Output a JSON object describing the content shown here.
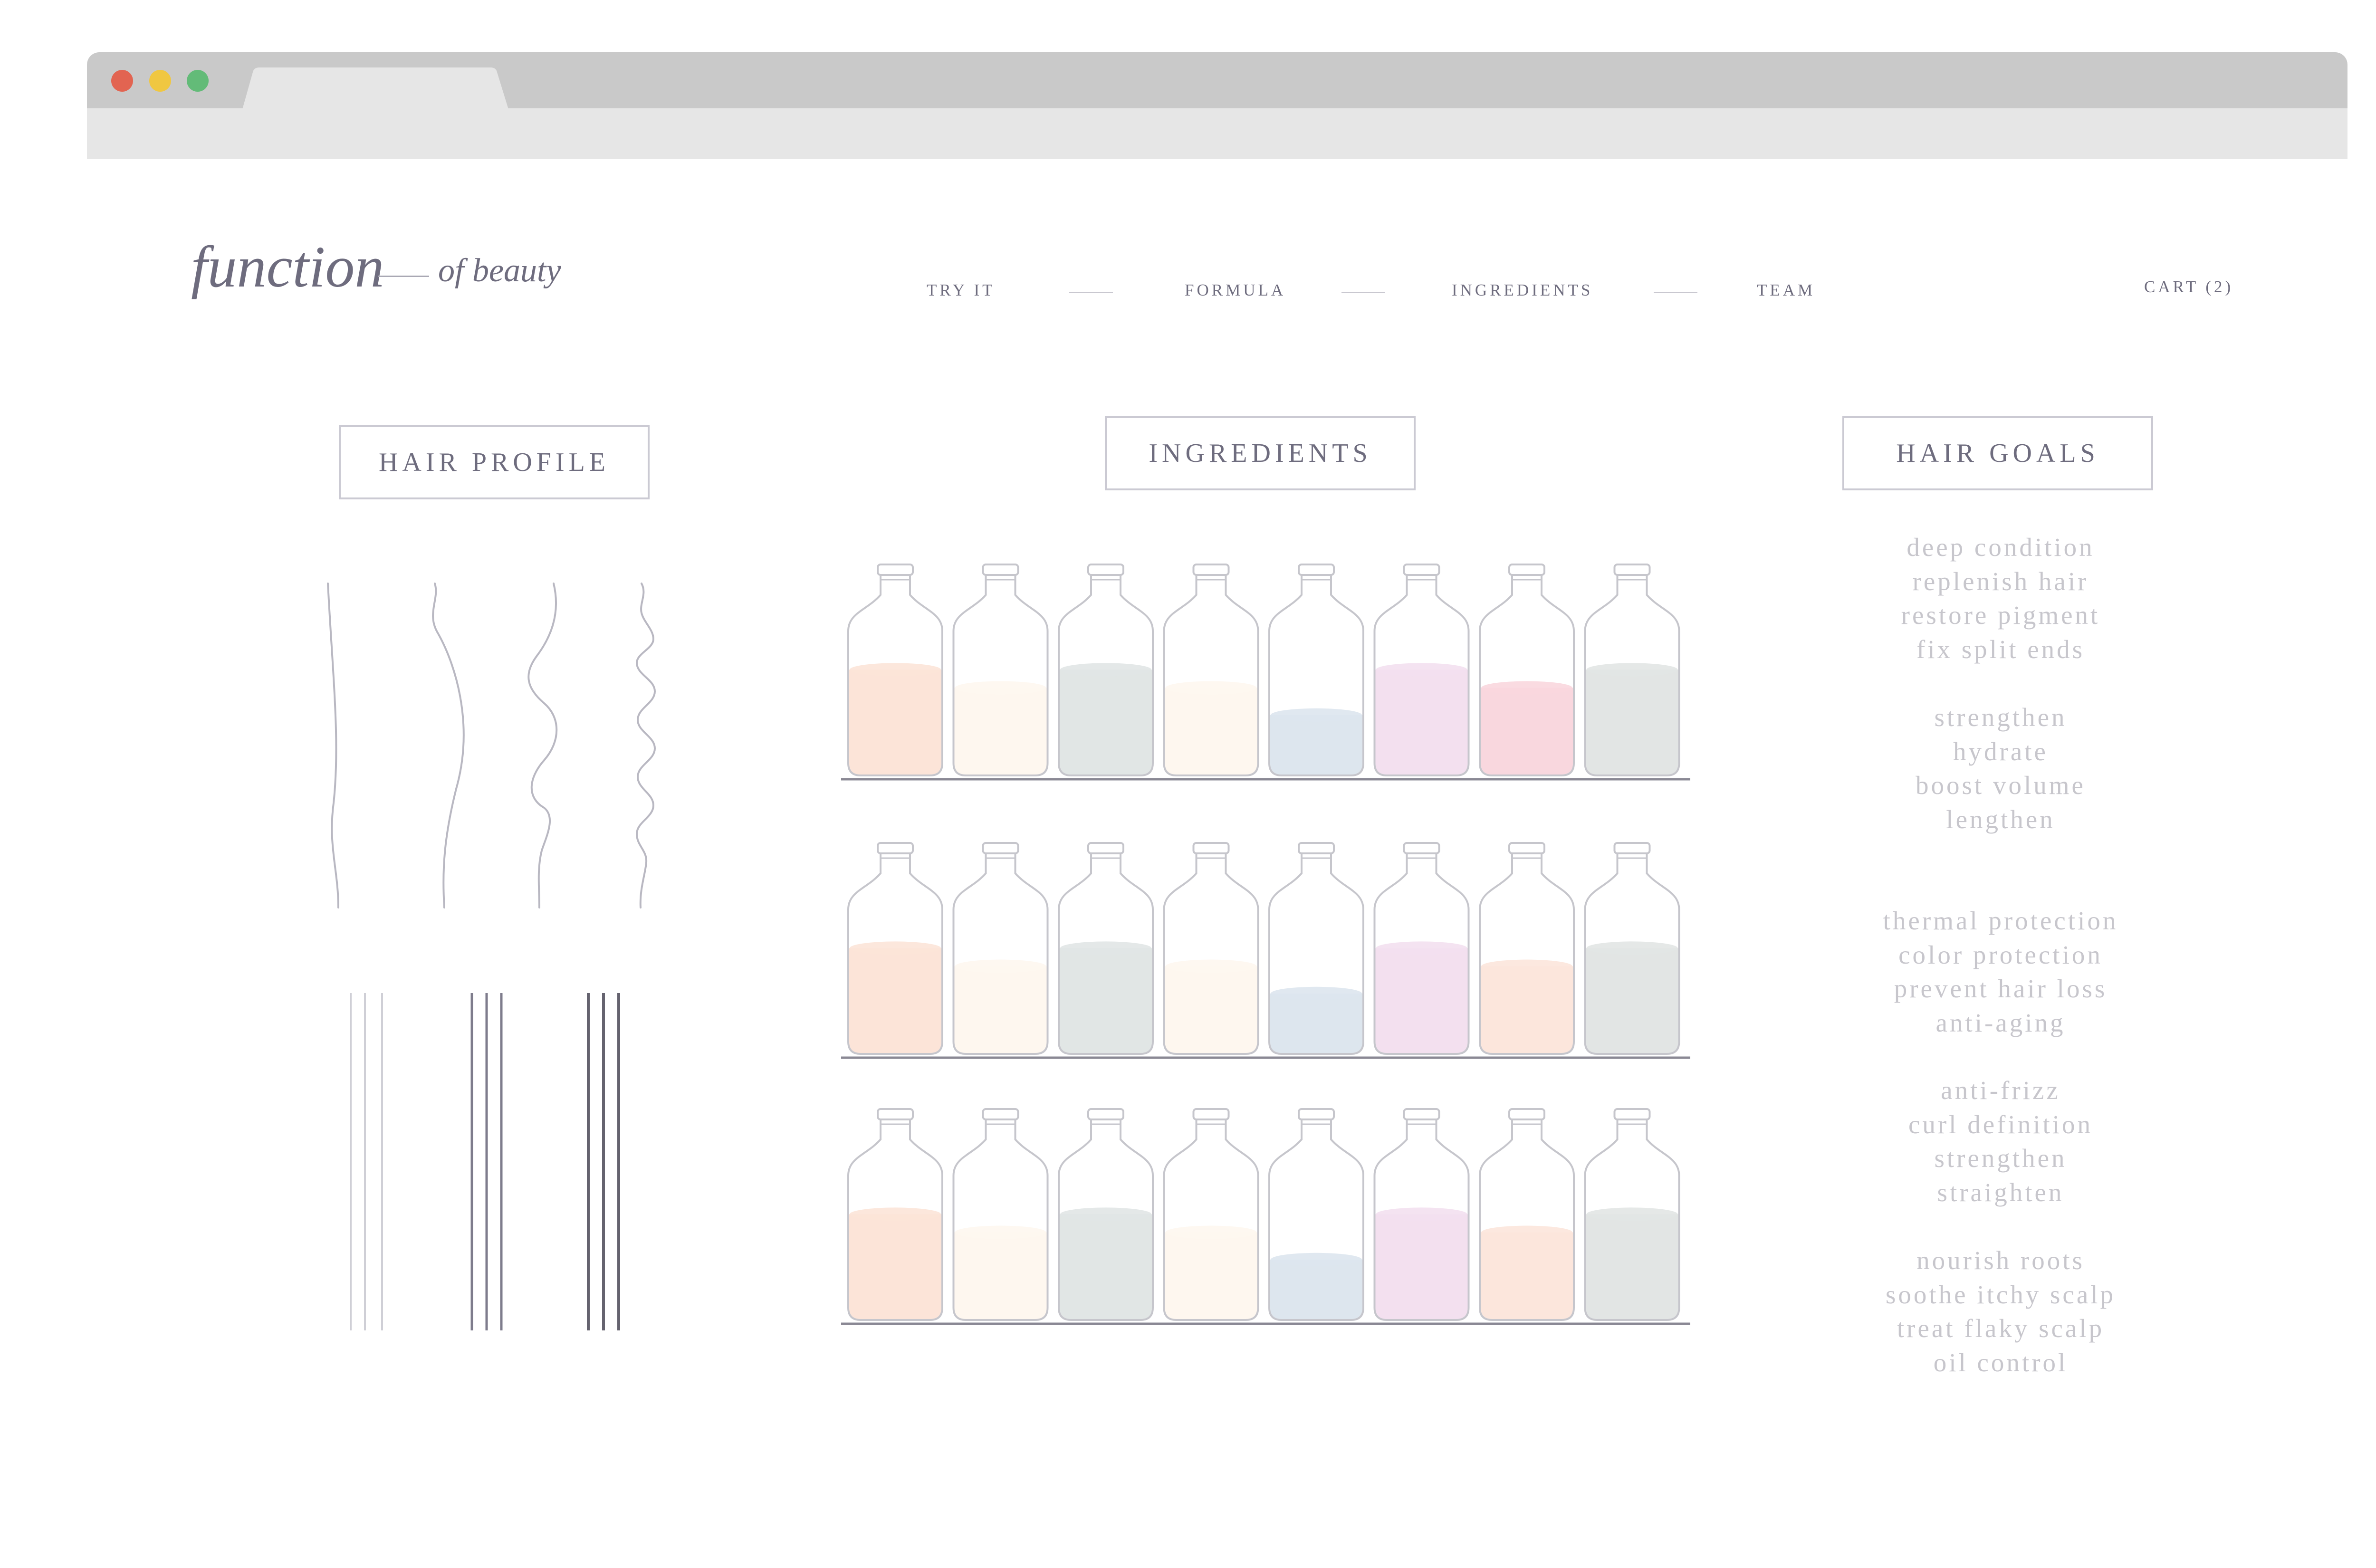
{
  "browser": {
    "window_controls": [
      "close-dot",
      "minimize-dot",
      "maximize-dot"
    ]
  },
  "brand": {
    "logo_main": "function",
    "logo_sub": "of beauty"
  },
  "nav": {
    "items": [
      "TRY IT",
      "FORMULA",
      "INGREDIENTS",
      "TEAM"
    ],
    "cart": "CART (2)"
  },
  "sections": {
    "hair_profile": "HAIR PROFILE",
    "ingredients": "INGREDIENTS",
    "hair_goals": "HAIR GOALS"
  },
  "hair_profile": {
    "hair_types": [
      "straight",
      "wavy",
      "curly",
      "coily"
    ],
    "strand_groups": [
      "thin",
      "medium",
      "thick"
    ]
  },
  "ingredients": {
    "shelves": [
      {
        "fills": [
          0.7,
          0.58,
          0.7,
          0.58,
          0.4,
          0.7,
          0.58,
          0.7
        ],
        "colors": [
          "#fce4d8",
          "#fef7ef",
          "#e1e6e5",
          "#fef7ef",
          "#dde6ee",
          "#f3e0ef",
          "#f9d7de",
          "#e2e5e4"
        ]
      },
      {
        "fills": [
          0.7,
          0.58,
          0.7,
          0.58,
          0.4,
          0.7,
          0.58,
          0.7
        ],
        "colors": [
          "#fce4d8",
          "#fef7ef",
          "#e1e6e5",
          "#fef7ef",
          "#dde6ee",
          "#f3e0ef",
          "#fce6dc",
          "#e2e5e4"
        ]
      },
      {
        "fills": [
          0.7,
          0.58,
          0.7,
          0.58,
          0.4,
          0.7,
          0.58,
          0.7
        ],
        "colors": [
          "#fce4d8",
          "#fef7ef",
          "#e1e6e5",
          "#fef7ef",
          "#dde6ee",
          "#f3e0ef",
          "#fce6dc",
          "#e2e5e4"
        ]
      }
    ]
  },
  "hair_goals": [
    [
      "deep condition",
      "replenish hair",
      "restore pigment",
      "fix split ends"
    ],
    [
      "strengthen",
      "hydrate",
      "boost volume",
      "lengthen"
    ],
    [
      "thermal protection",
      "color protection",
      "prevent hair loss",
      "anti-aging"
    ],
    [
      "anti-frizz",
      "curl definition",
      "strengthen",
      "straighten"
    ],
    [
      "nourish roots",
      "soothe itchy scalp",
      "treat flaky scalp",
      "oil control"
    ]
  ],
  "colors": {
    "text": "#6e6c7e",
    "goal_text": "#c7c6cc",
    "box_border": "#cbcad3",
    "shelf": "#8a8894",
    "bottle_outline": "#c6c6cc"
  }
}
